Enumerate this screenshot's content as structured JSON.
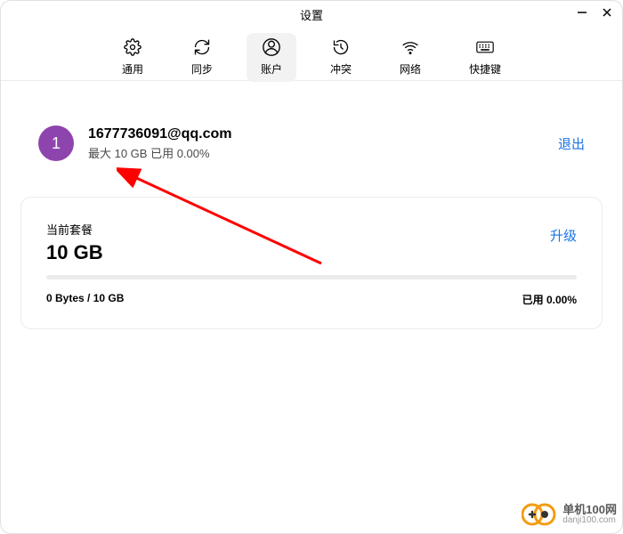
{
  "window": {
    "title": "设置"
  },
  "tabs": {
    "general": "通用",
    "sync": "同步",
    "account": "账户",
    "conflict": "冲突",
    "network": "网络",
    "shortcuts": "快捷键"
  },
  "account": {
    "avatar_initial": "1",
    "email": "1677736091@qq.com",
    "storage_line": "最大 10 GB 已用 0.00%",
    "logout_label": "退出"
  },
  "plan": {
    "current_label": "当前套餐",
    "size": "10 GB",
    "upgrade_label": "升级",
    "usage_bytes": "0 Bytes / 10 GB",
    "usage_percent": "已用 0.00%"
  },
  "watermark": {
    "main": "单机100网",
    "sub": "danji100.com"
  }
}
